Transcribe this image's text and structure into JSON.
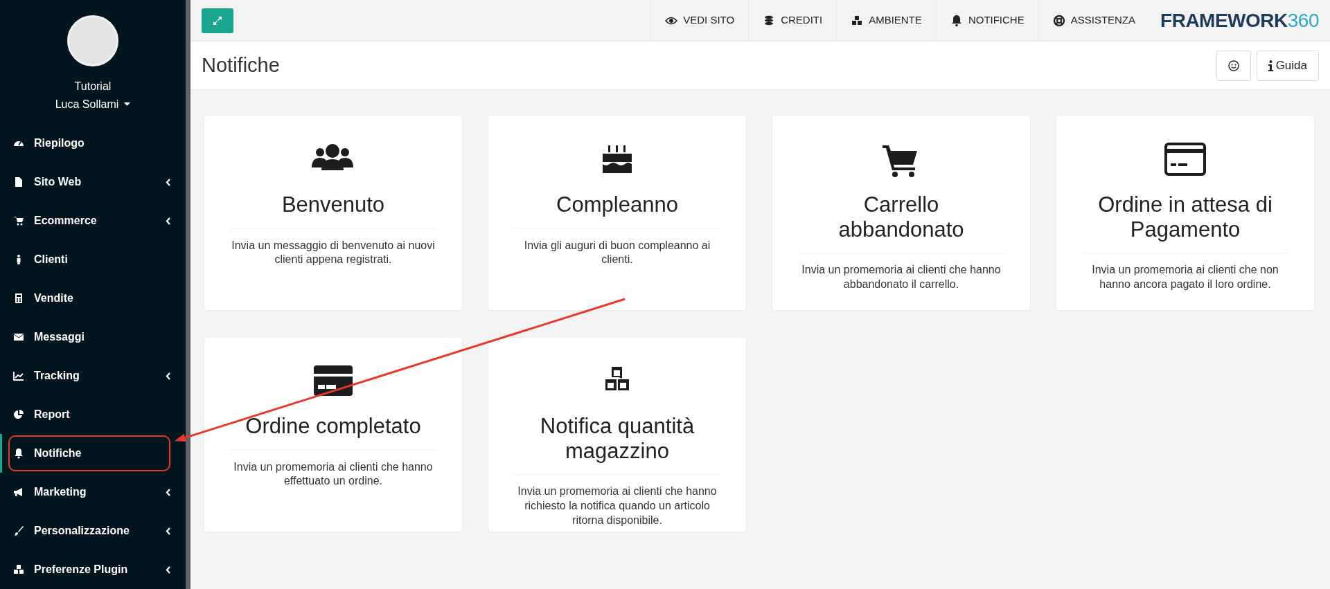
{
  "sidebar": {
    "user": {
      "line1": "Tutorial",
      "line2": "Luca Sollami"
    },
    "items": [
      {
        "label": "Riepilogo",
        "has_submenu": false,
        "selected": false,
        "highlighted": false
      },
      {
        "label": "Sito Web",
        "has_submenu": true,
        "selected": false,
        "highlighted": false
      },
      {
        "label": "Ecommerce",
        "has_submenu": true,
        "selected": false,
        "highlighted": false
      },
      {
        "label": "Clienti",
        "has_submenu": false,
        "selected": false,
        "highlighted": false
      },
      {
        "label": "Vendite",
        "has_submenu": false,
        "selected": false,
        "highlighted": false
      },
      {
        "label": "Messaggi",
        "has_submenu": false,
        "selected": false,
        "highlighted": false
      },
      {
        "label": "Tracking",
        "has_submenu": true,
        "selected": false,
        "highlighted": false
      },
      {
        "label": "Report",
        "has_submenu": false,
        "selected": false,
        "highlighted": false
      },
      {
        "label": "Notifiche",
        "has_submenu": false,
        "selected": true,
        "highlighted": true
      },
      {
        "label": "Marketing",
        "has_submenu": true,
        "selected": false,
        "highlighted": false
      },
      {
        "label": "Personalizzazione",
        "has_submenu": true,
        "selected": false,
        "highlighted": false
      },
      {
        "label": "Preferenze Plugin",
        "has_submenu": true,
        "selected": false,
        "highlighted": false
      }
    ]
  },
  "topbar": {
    "links": [
      "VEDI SITO",
      "CREDITI",
      "AMBIENTE",
      "NOTIFICHE",
      "ASSISTENZA"
    ],
    "logo": {
      "text": "FRAMEWORK",
      "accent": "360"
    }
  },
  "page": {
    "title": "Notifiche",
    "help_button": "Guida"
  },
  "cards": [
    {
      "title": "Benvenuto",
      "description": "Invia un messaggio di benvenuto ai nuovi clienti appena registrati."
    },
    {
      "title": "Compleanno",
      "description": "Invia gli auguri di buon compleanno ai clienti."
    },
    {
      "title": "Carrello abbandonato",
      "description": "Invia un promemoria ai clienti che hanno abbandonato il carrello."
    },
    {
      "title": "Ordine in attesa di Pagamento",
      "description": "Invia un promemoria ai clienti che non hanno ancora pagato il loro ordine."
    },
    {
      "title": "Ordine completato",
      "description": "Invia un promemoria ai clienti che hanno effettuato un ordine."
    },
    {
      "title": "Notifica quantità magazzino",
      "description": "Invia un promemoria ai clienti che hanno richiesto la notifica quando un articolo ritorna disponibile."
    }
  ]
}
